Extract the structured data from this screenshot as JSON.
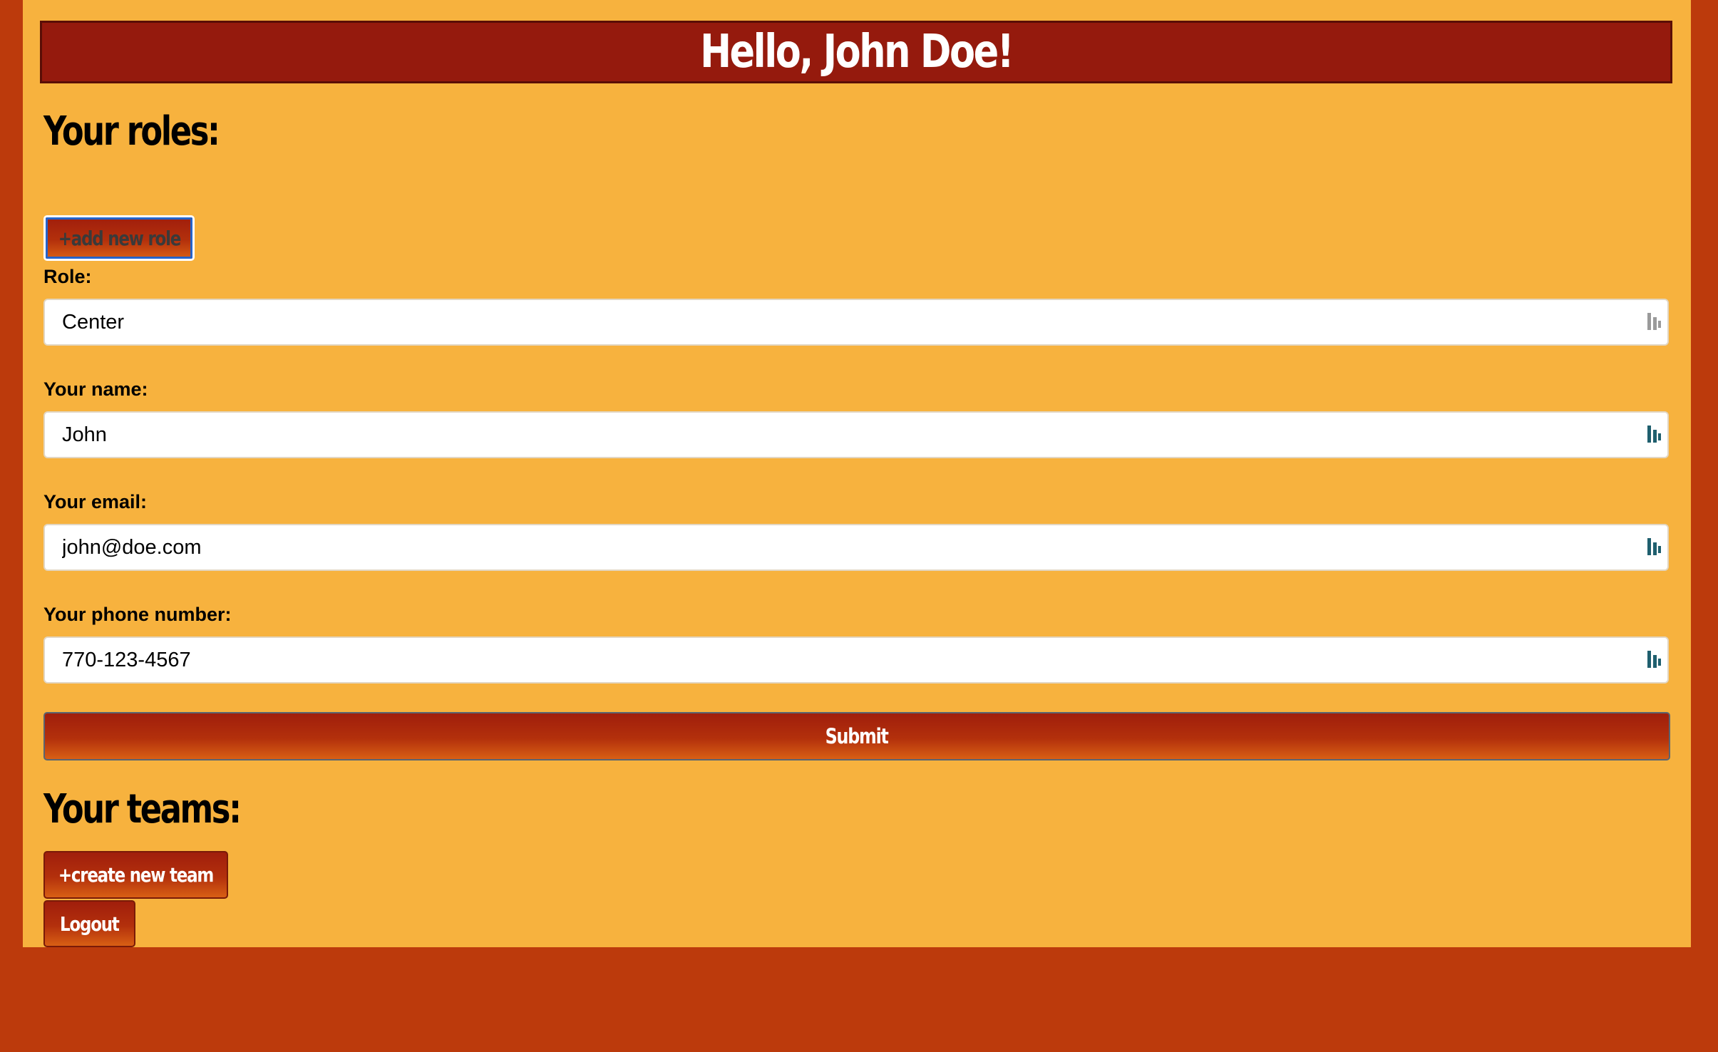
{
  "header": {
    "greeting": "Hello, John Doe!"
  },
  "roles": {
    "heading": "Your roles:",
    "add_button_label": "+add new role"
  },
  "form": {
    "fields": [
      {
        "label": "Role:",
        "value": "Center"
      },
      {
        "label": "Your name:",
        "value": "John"
      },
      {
        "label": "Your email:",
        "value": "john@doe.com"
      },
      {
        "label": "Your phone number:",
        "value": "770-123-4567"
      }
    ],
    "submit_label": "Submit"
  },
  "teams": {
    "heading": "Your teams:",
    "create_button_label": "+create new team"
  },
  "logout_label": "Logout",
  "colors": {
    "background": "#bc3a0c",
    "panel": "#f7b23e",
    "header": "#951a0d",
    "button_top": "#a01e0c",
    "button_bottom": "#d85f14"
  },
  "icons": {
    "field_icon": "password-manager-icon"
  }
}
